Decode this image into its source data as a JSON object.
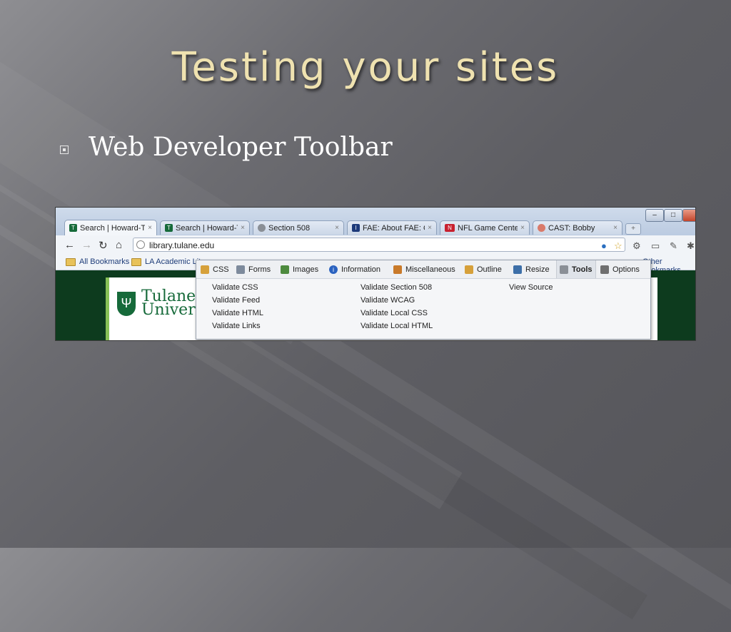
{
  "slide": {
    "title": "Testing your sites",
    "bullet": "Web Developer Toolbar"
  },
  "browser": {
    "window_controls": {
      "minimize": "–",
      "maximize": "□",
      "close": "x"
    },
    "tabs": [
      {
        "label": "Search | Howard-Til",
        "active": true
      },
      {
        "label": "Search | Howard-Til",
        "active": false
      },
      {
        "label": "Section 508",
        "active": false
      },
      {
        "label": "FAE: About FAE: Ov",
        "active": false
      },
      {
        "label": "NFL Game Center: F",
        "active": false
      },
      {
        "label": "CAST: Bobby",
        "active": false
      }
    ],
    "tab_close": "×",
    "address": "library.tulane.edu",
    "bookmarks": [
      {
        "label": "All Bookmarks"
      },
      {
        "label": "LA Academic Lit"
      }
    ],
    "other_bookmarks": "Other bookmarks",
    "page": {
      "logo_line1": "Tulane",
      "logo_line2": "Univers"
    }
  },
  "webdev_toolbar": {
    "tabs": [
      "CSS",
      "Forms",
      "Images",
      "Information",
      "Miscellaneous",
      "Outline",
      "Resize",
      "Tools",
      "Options"
    ],
    "selected_tab": "Tools",
    "column1": [
      "Validate CSS",
      "Validate Feed",
      "Validate HTML",
      "Validate Links"
    ],
    "column2": [
      "Validate Section 508",
      "Validate WCAG",
      "Validate Local CSS",
      "Validate Local HTML"
    ],
    "column3": [
      "View Source"
    ]
  },
  "colors": {
    "title": "#efe2b0",
    "page_green": "#0d3b1e",
    "tulane_green": "#166a3a"
  }
}
